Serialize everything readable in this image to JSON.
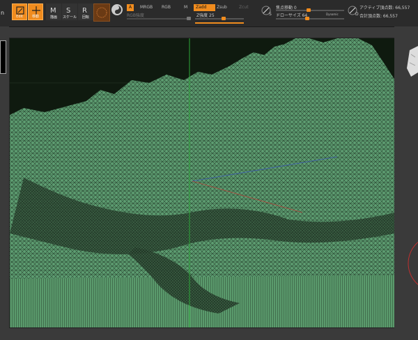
{
  "toolbar": {
    "edge_char": "n",
    "edit_label": "Edit",
    "move_label": "移動",
    "draw_label": "描画",
    "scale_label": "スケール",
    "rotate_label": "回転",
    "mode_a": "A",
    "mrgb": "MRGB",
    "rgb": "RGB",
    "m": "M",
    "zadd": "Zadd",
    "zsub": "Zsub",
    "zcut": "Zcut",
    "rgb_intensity": "RGB強度",
    "z_intensity": "Z強度 25",
    "focal_shift": "焦点移動 0",
    "draw_size": "ドローサイズ 64",
    "dynamic": "Dynamic",
    "active_points": "アクティブ頂点数: 66,557",
    "total_points": "合計頂点数: 66,557",
    "s_label": "S",
    "d_label": "D"
  },
  "sliders": {
    "z_intensity": 0.25,
    "focal_shift": 0.5,
    "draw_size": 0.25
  },
  "colors": {
    "accent": "#f08c1e",
    "mesh": "#5e9e72",
    "background": "#0f1a0f"
  },
  "icons": {
    "edit": "edit-icon",
    "move": "move-icon",
    "draw": "draw-icon",
    "scale": "scale-icon",
    "rotate": "rotate-icon",
    "material": "material-sphere-icon",
    "texture": "texture-icon"
  }
}
